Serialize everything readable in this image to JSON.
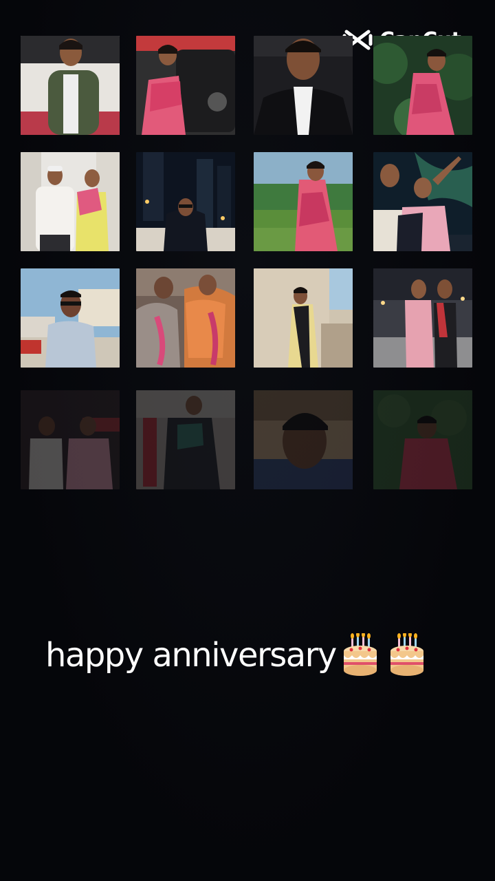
{
  "watermark": {
    "brand": "CapCut",
    "icon": "capcut-logo-icon"
  },
  "caption": {
    "text": "happy anniversary",
    "emojis": [
      "birthday-cake-icon",
      "birthday-cake-icon"
    ]
  },
  "grid": {
    "rows": [
      {
        "tiles": [
          "photo-man-olive-shirt",
          "photo-woman-pink-saree-car",
          "photo-boy-black-shirt",
          "photo-woman-pink-outfit-garden"
        ]
      },
      {
        "tiles": [
          "photo-couple-hallway",
          "photo-man-city-night",
          "photo-woman-pink-saree-field",
          "photo-couple-aurora"
        ]
      },
      {
        "tiles": [
          "photo-man-sunglasses-street",
          "photo-wedding-garlands",
          "photo-woman-yellow-saree",
          "photo-couple-night-market"
        ]
      },
      {
        "tiles": [
          "photo-couple-faded",
          "photo-woman-black-saree-faded",
          "photo-man-closeup-faded",
          "photo-woman-green-wall-faded"
        ]
      }
    ]
  },
  "colors": {
    "background": "#05060a",
    "text": "#ffffff"
  }
}
